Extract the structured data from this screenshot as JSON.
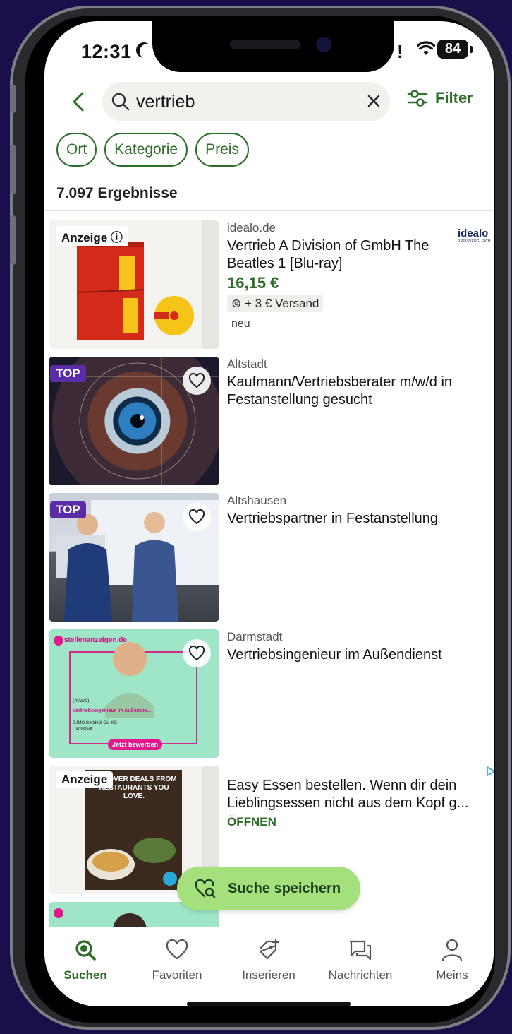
{
  "status": {
    "time": "12:31",
    "battery": "84",
    "excl": "!"
  },
  "search": {
    "query": "vertrieb",
    "filter_label": "Filter"
  },
  "chips": [
    "Ort",
    "Kategorie",
    "Preis"
  ],
  "result_count": "7.097 Ergebnisse",
  "items": [
    {
      "seller": "idealo.de",
      "title": "Vertrieb A Division of GmbH The Beatles 1 [Blu-ray]",
      "price": "16,15 €",
      "shipping": "+ 3 € Versand",
      "condition": "neu",
      "badge": "Anzeige ⓘ",
      "brand_logo": "idealo",
      "brand_sub": "PREISVERGLEICH"
    },
    {
      "location": "Altstadt",
      "title": "Kaufmann/Vertriebsberater m/w/d in Festanstellung gesucht",
      "badge": "TOP"
    },
    {
      "location": "Altshausen",
      "title": "Vertriebspartner in Festanstellung",
      "badge": "TOP"
    },
    {
      "location": "Darmstadt",
      "title": "Vertriebsingenieur im Außendienst",
      "thumb_brand": "stellenanzeigen.de",
      "thumb_tag": "(m/w/d)",
      "thumb_title": "Vertriebsingenieur im Außendie...",
      "thumb_company": "JUMO GmbH & Co. KG",
      "thumb_city": "Darmstadt",
      "thumb_cta": "Jetzt bewerben"
    },
    {
      "title": "Easy Essen bestellen. Wenn dir dein Lieblingsessen nicht aus dem Kopf g...",
      "cta": "ÖFFNEN",
      "badge": "Anzeige",
      "thumb_headline": "DISCOVER DEALS FROM RESTAURANTS YOU LOVE."
    }
  ],
  "save_search": "Suche speichern",
  "nav": [
    {
      "label": "Suchen",
      "icon": "search-icon",
      "active": true
    },
    {
      "label": "Favoriten",
      "icon": "heart-icon",
      "active": false
    },
    {
      "label": "Inserieren",
      "icon": "tag-plus-icon",
      "active": false
    },
    {
      "label": "Nachrichten",
      "icon": "chat-icon",
      "active": false
    },
    {
      "label": "Meins",
      "icon": "user-icon",
      "active": false
    }
  ],
  "colors": {
    "brand_green": "#2e6e2a",
    "save_button": "#a4e17c",
    "top_badge": "#5b2ca8",
    "background": "#1a0f4a"
  }
}
